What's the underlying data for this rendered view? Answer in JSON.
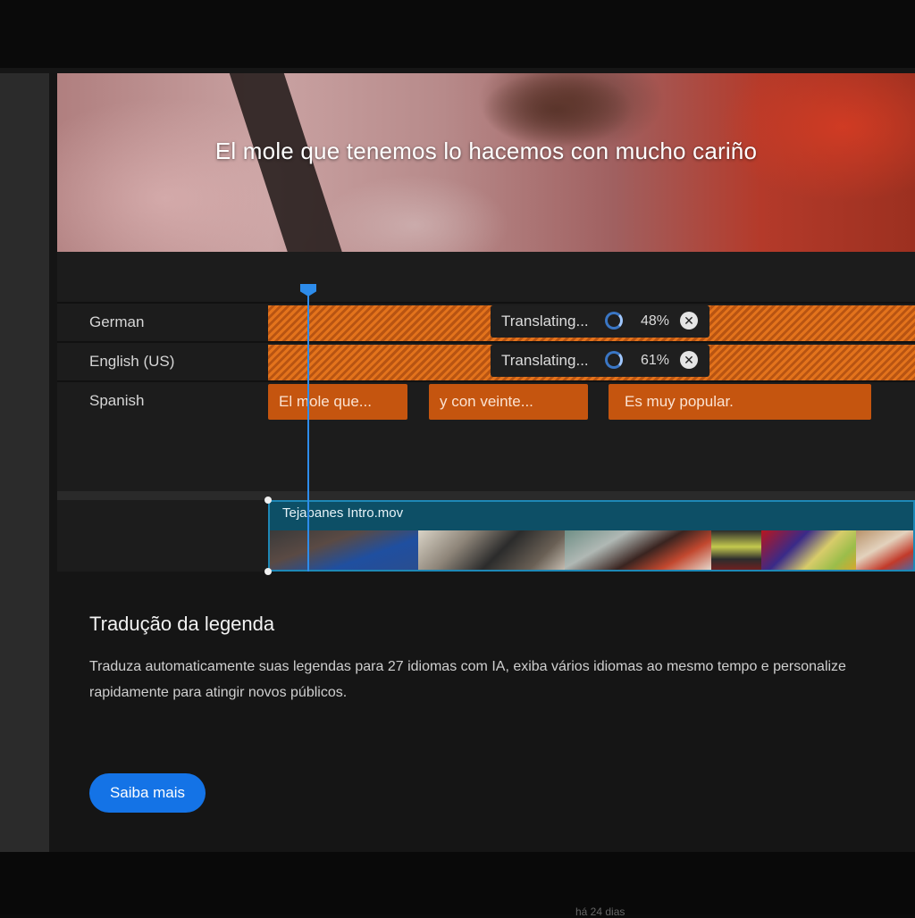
{
  "preview": {
    "subtitle": "El mole que tenemos lo hacemos con mucho cariño"
  },
  "timeline": {
    "tracks": [
      {
        "label": "German",
        "status": "Translating...",
        "percent": "48%",
        "progress": 0.48
      },
      {
        "label": "English (US)",
        "status": "Translating...",
        "percent": "61%",
        "progress": 0.61
      },
      {
        "label": "Spanish",
        "clips": [
          "El mole que...",
          "y con veinte...",
          "Es muy popular."
        ]
      }
    ],
    "video_clip": {
      "name": "Tejabanes Intro.mov"
    }
  },
  "description": {
    "title": "Tradução da legenda",
    "body": "Traduza automaticamente suas legendas para 27 idiomas com IA, exiba vários idiomas ao mesmo tempo e personalize rapidamente para atingir novos públicos.",
    "cta_label": "Saiba mais"
  },
  "footer": {
    "meta": "há 24 dias"
  },
  "colors": {
    "accent_blue": "#1473e6",
    "playhead": "#2d8ceb",
    "caption_clip": "#c5550f",
    "translating_hatch": "#e3731c",
    "video_clip": "#0d4f66"
  },
  "icons": [
    "spinner-icon",
    "cancel-icon",
    "playhead-icon"
  ]
}
